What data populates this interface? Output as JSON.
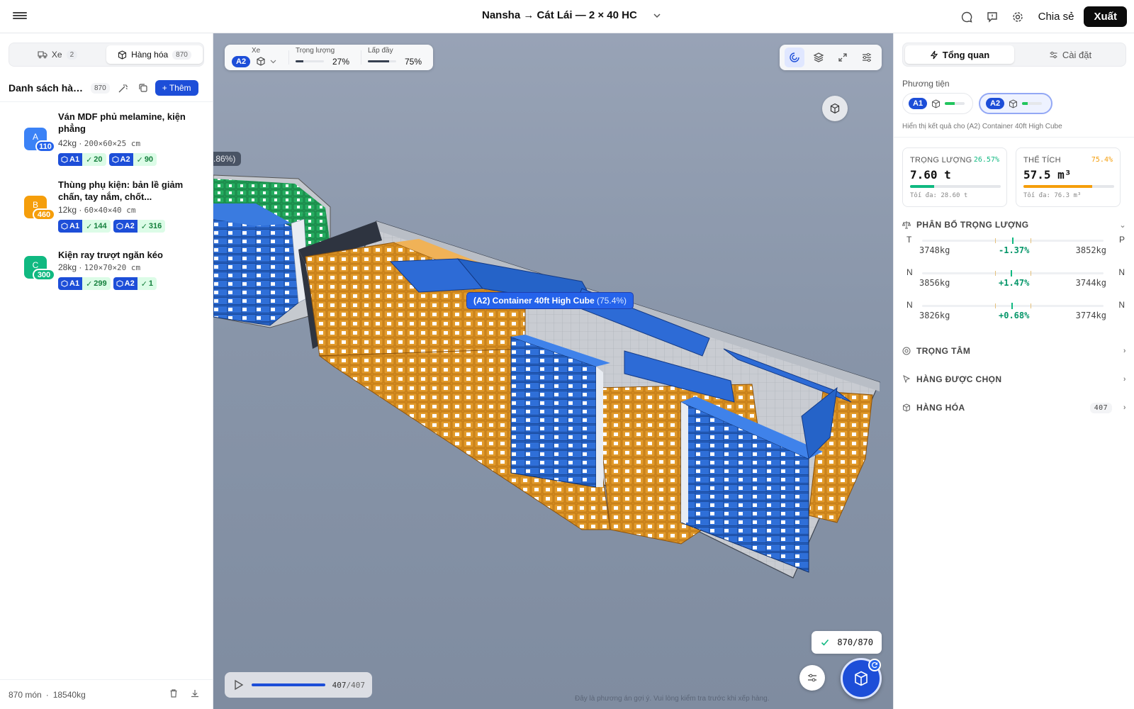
{
  "header": {
    "title": "Nansha → Cát Lái — 2 × 40 HC",
    "share_label": "Chia sẻ",
    "export_label": "Xuất"
  },
  "left_panel": {
    "tabs": [
      {
        "label": "Xe",
        "count": "2"
      },
      {
        "label": "Hàng hóa",
        "count": "870"
      }
    ],
    "list_title": "Danh sách hàn...",
    "list_count": "870",
    "add_label": "Thêm",
    "items": [
      {
        "letter": "A",
        "count": "110",
        "color": "#3b82f6",
        "name": "Ván MDF phủ melamine, kiện phẳng",
        "weight": "42kg",
        "dims": "200×60×25 cm",
        "alloc": [
          {
            "vehicle": "A1",
            "qty": "20"
          },
          {
            "vehicle": "A2",
            "qty": "90"
          }
        ]
      },
      {
        "letter": "B",
        "count": "460",
        "color": "#f59e0b",
        "name": "Thùng phụ kiện: bản lề giảm chấn, tay nắm, chốt...",
        "weight": "12kg",
        "dims": "60×40×40 cm",
        "alloc": [
          {
            "vehicle": "A1",
            "qty": "144"
          },
          {
            "vehicle": "A2",
            "qty": "316"
          }
        ]
      },
      {
        "letter": "C",
        "count": "300",
        "color": "#10b981",
        "name": "Kiện ray trượt ngăn kéo",
        "weight": "28kg",
        "dims": "120×70×20 cm",
        "alloc": [
          {
            "vehicle": "A1",
            "qty": "299"
          },
          {
            "vehicle": "A2",
            "qty": "1"
          }
        ]
      }
    ],
    "footer": {
      "items": "870 món",
      "weight": "18540kg"
    }
  },
  "viewport": {
    "hud": {
      "vehicle_label": "Xe",
      "vehicle_value": "A2",
      "weight_label": "Trọng lượng",
      "weight_value": "27%",
      "weight_fraction": 0.27,
      "fill_label": "Lấp đầy",
      "fill_value": "75%",
      "fill_fraction": 0.75
    },
    "container_tag": {
      "name": "(A2) Container 40ft High Cube",
      "pct": "(75.4%)"
    },
    "left_tag": ".86%)",
    "playback": {
      "current": "407",
      "total": "/407",
      "fraction": 1.0
    },
    "done_count": "870/870",
    "disclaimer": "Đây là phương án gợi ý. Vui lòng kiểm tra trước khi xếp hàng."
  },
  "right_panel": {
    "tabs": [
      {
        "label": "Tổng quan"
      },
      {
        "label": "Cài đặt"
      }
    ],
    "vehicles_label": "Phương tiện",
    "vehicles": [
      {
        "code": "A1",
        "fill": 0.5,
        "active": false
      },
      {
        "code": "A2",
        "fill": 0.28,
        "active": true
      }
    ],
    "vehicle_note": "Hiển thị kết quả cho (A2) Container 40ft High Cube",
    "weight": {
      "label": "TRỌNG LƯỢNG",
      "pct": "26.57%",
      "value": "7.60 t",
      "max": "Tối đa: 28.60 t",
      "fraction": 0.2657,
      "color": "#10b981"
    },
    "volume": {
      "label": "THỂ TÍCH",
      "pct": "75.4%",
      "value": "57.5 m³",
      "max": "Tối đa: 76.3 m³",
      "fraction": 0.754,
      "color": "#f59e0b"
    },
    "distribution": {
      "title": "PHÂN BỔ TRỌNG LƯỢNG",
      "rows": [
        {
          "left": "T",
          "right": "P",
          "kl": "3748kg",
          "delta": "-1.37%",
          "kr": "3852kg"
        },
        {
          "left": "N",
          "right": "N",
          "kl": "3856kg",
          "delta": "+1.47%",
          "kr": "3744kg"
        },
        {
          "left": "N",
          "right": "N",
          "kl": "3826kg",
          "delta": "+0.68%",
          "kr": "3774kg"
        }
      ]
    },
    "sections": [
      {
        "title": "TRỌNG TÂM"
      },
      {
        "title": "HÀNG ĐƯỢC CHỌN"
      },
      {
        "title": "HÀNG HÓA",
        "badge": "407"
      }
    ]
  }
}
